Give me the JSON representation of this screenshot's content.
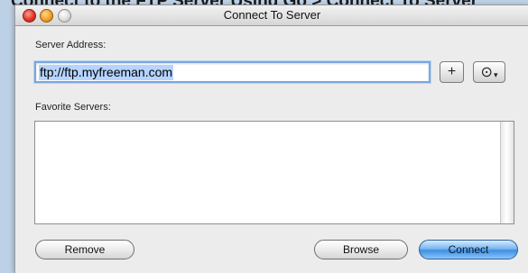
{
  "background_text": "Connect to the FTP Server Using Go > Connect To Server",
  "window": {
    "title": "Connect To Server",
    "controls": {
      "close": "close-control",
      "minimize": "minimize-control",
      "zoom": "zoom-control"
    }
  },
  "server_address": {
    "label": "Server Address:",
    "value": "ftp://ftp.myfreeman.com"
  },
  "buttons": {
    "add_symbol": "+",
    "recent_symbol": "⊙",
    "remove": "Remove",
    "browse": "Browse",
    "connect": "Connect"
  },
  "favorites": {
    "label": "Favorite Servers:",
    "items": []
  },
  "colors": {
    "default_button": "#5aa2eb",
    "selection": "#b5d4ff",
    "focus_ring": "#7aa7de"
  }
}
